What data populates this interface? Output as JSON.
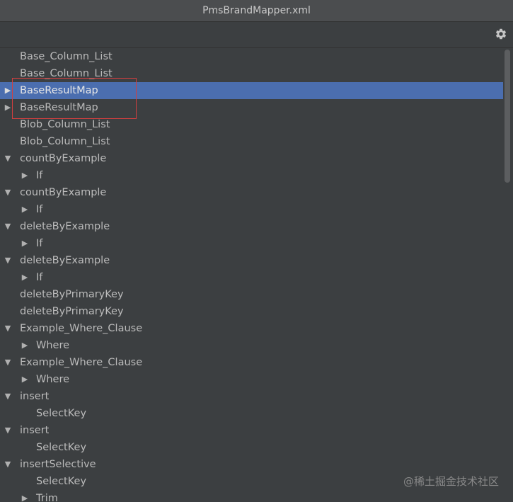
{
  "window": {
    "title": "PmsBrandMapper.xml"
  },
  "toolbar": {
    "settings_icon": "gear-icon"
  },
  "tree": {
    "rows": [
      {
        "label": "Base_Column_List",
        "level": 0,
        "arrow": ""
      },
      {
        "label": "Base_Column_List",
        "level": 0,
        "arrow": ""
      },
      {
        "label": "BaseResultMap",
        "level": 0,
        "arrow": "▶",
        "selected": true
      },
      {
        "label": "BaseResultMap",
        "level": 0,
        "arrow": "▶"
      },
      {
        "label": "Blob_Column_List",
        "level": 0,
        "arrow": ""
      },
      {
        "label": "Blob_Column_List",
        "level": 0,
        "arrow": ""
      },
      {
        "label": "countByExample",
        "level": 0,
        "arrow": "▼"
      },
      {
        "label": "If",
        "level": 1,
        "arrow": "▶"
      },
      {
        "label": "countByExample",
        "level": 0,
        "arrow": "▼"
      },
      {
        "label": "If",
        "level": 1,
        "arrow": "▶"
      },
      {
        "label": "deleteByExample",
        "level": 0,
        "arrow": "▼"
      },
      {
        "label": "If",
        "level": 1,
        "arrow": "▶"
      },
      {
        "label": "deleteByExample",
        "level": 0,
        "arrow": "▼"
      },
      {
        "label": "If",
        "level": 1,
        "arrow": "▶"
      },
      {
        "label": "deleteByPrimaryKey",
        "level": 0,
        "arrow": ""
      },
      {
        "label": "deleteByPrimaryKey",
        "level": 0,
        "arrow": ""
      },
      {
        "label": "Example_Where_Clause",
        "level": 0,
        "arrow": "▼"
      },
      {
        "label": "Where",
        "level": 1,
        "arrow": "▶"
      },
      {
        "label": "Example_Where_Clause",
        "level": 0,
        "arrow": "▼"
      },
      {
        "label": "Where",
        "level": 1,
        "arrow": "▶"
      },
      {
        "label": "insert",
        "level": 0,
        "arrow": "▼"
      },
      {
        "label": "SelectKey",
        "level": 1,
        "arrow": ""
      },
      {
        "label": "insert",
        "level": 0,
        "arrow": "▼"
      },
      {
        "label": "SelectKey",
        "level": 1,
        "arrow": ""
      },
      {
        "label": "insertSelective",
        "level": 0,
        "arrow": "▼"
      },
      {
        "label": "SelectKey",
        "level": 1,
        "arrow": ""
      },
      {
        "label": "Trim",
        "level": 1,
        "arrow": "▶"
      }
    ]
  },
  "watermark": "@稀土掘金技术社区"
}
